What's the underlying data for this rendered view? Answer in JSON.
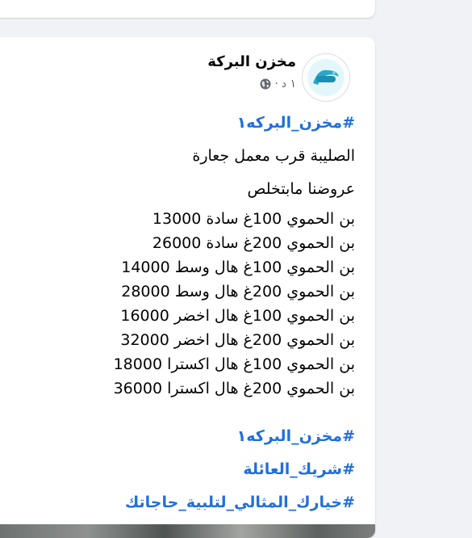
{
  "post": {
    "page_name": "مخزن البركة",
    "time": "١ د",
    "hashtag_top": "#مخزن_البركه١",
    "location_line": "الصليبة قرب معمل جعارة",
    "offer_line": "عروضنا مابتخلص",
    "price_lines": [
      "بن الحموي 100غ سادة 13000",
      "بن الحموي 200غ سادة 26000",
      "بن الحموي 100غ هال وسط 14000",
      "بن الحموي 200غ هال وسط 28000",
      "بن الحموي 100غ هال اخضر 16000",
      "بن الحموي 200غ هال اخضر 32000",
      "بن الحموي 100غ هال اكسترا 18000",
      "بن الحموي 200غ هال اكسترا 36000"
    ],
    "hashtags_bottom": [
      "#مخزن_البركه١",
      "#شريك_العائلة",
      "#خيارك_المثالي_لتلبية_حاجاتك"
    ]
  },
  "icons": {
    "avatar": "page-logo-icon",
    "audience": "globe-icon"
  },
  "colors": {
    "link": "#216fdb",
    "text": "#050505",
    "secondary": "#65676b",
    "background": "#f0f2f5"
  }
}
